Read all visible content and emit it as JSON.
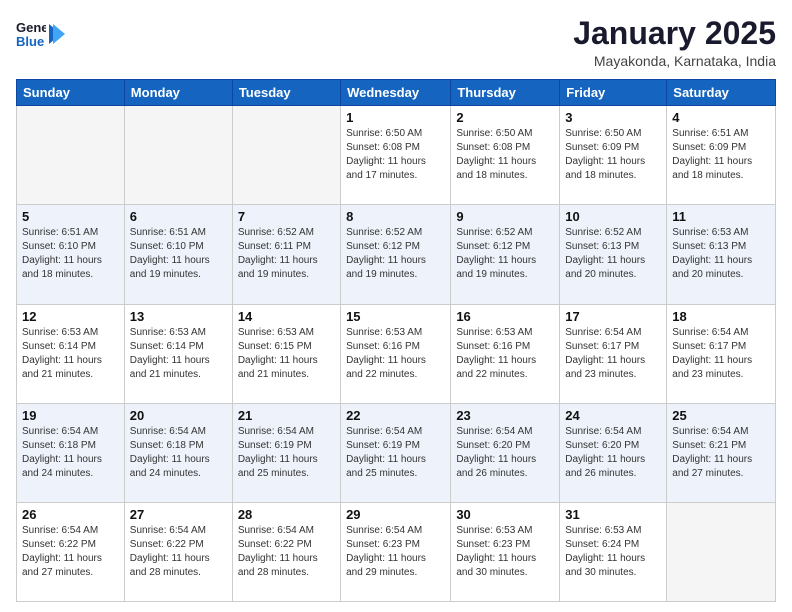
{
  "header": {
    "logo_line1": "General",
    "logo_line2": "Blue",
    "title": "January 2025",
    "subtitle": "Mayakonda, Karnataka, India"
  },
  "weekdays": [
    "Sunday",
    "Monday",
    "Tuesday",
    "Wednesday",
    "Thursday",
    "Friday",
    "Saturday"
  ],
  "weeks": [
    [
      {
        "day": "",
        "info": ""
      },
      {
        "day": "",
        "info": ""
      },
      {
        "day": "",
        "info": ""
      },
      {
        "day": "1",
        "info": "Sunrise: 6:50 AM\nSunset: 6:08 PM\nDaylight: 11 hours\nand 17 minutes."
      },
      {
        "day": "2",
        "info": "Sunrise: 6:50 AM\nSunset: 6:08 PM\nDaylight: 11 hours\nand 18 minutes."
      },
      {
        "day": "3",
        "info": "Sunrise: 6:50 AM\nSunset: 6:09 PM\nDaylight: 11 hours\nand 18 minutes."
      },
      {
        "day": "4",
        "info": "Sunrise: 6:51 AM\nSunset: 6:09 PM\nDaylight: 11 hours\nand 18 minutes."
      }
    ],
    [
      {
        "day": "5",
        "info": "Sunrise: 6:51 AM\nSunset: 6:10 PM\nDaylight: 11 hours\nand 18 minutes."
      },
      {
        "day": "6",
        "info": "Sunrise: 6:51 AM\nSunset: 6:10 PM\nDaylight: 11 hours\nand 19 minutes."
      },
      {
        "day": "7",
        "info": "Sunrise: 6:52 AM\nSunset: 6:11 PM\nDaylight: 11 hours\nand 19 minutes."
      },
      {
        "day": "8",
        "info": "Sunrise: 6:52 AM\nSunset: 6:12 PM\nDaylight: 11 hours\nand 19 minutes."
      },
      {
        "day": "9",
        "info": "Sunrise: 6:52 AM\nSunset: 6:12 PM\nDaylight: 11 hours\nand 19 minutes."
      },
      {
        "day": "10",
        "info": "Sunrise: 6:52 AM\nSunset: 6:13 PM\nDaylight: 11 hours\nand 20 minutes."
      },
      {
        "day": "11",
        "info": "Sunrise: 6:53 AM\nSunset: 6:13 PM\nDaylight: 11 hours\nand 20 minutes."
      }
    ],
    [
      {
        "day": "12",
        "info": "Sunrise: 6:53 AM\nSunset: 6:14 PM\nDaylight: 11 hours\nand 21 minutes."
      },
      {
        "day": "13",
        "info": "Sunrise: 6:53 AM\nSunset: 6:14 PM\nDaylight: 11 hours\nand 21 minutes."
      },
      {
        "day": "14",
        "info": "Sunrise: 6:53 AM\nSunset: 6:15 PM\nDaylight: 11 hours\nand 21 minutes."
      },
      {
        "day": "15",
        "info": "Sunrise: 6:53 AM\nSunset: 6:16 PM\nDaylight: 11 hours\nand 22 minutes."
      },
      {
        "day": "16",
        "info": "Sunrise: 6:53 AM\nSunset: 6:16 PM\nDaylight: 11 hours\nand 22 minutes."
      },
      {
        "day": "17",
        "info": "Sunrise: 6:54 AM\nSunset: 6:17 PM\nDaylight: 11 hours\nand 23 minutes."
      },
      {
        "day": "18",
        "info": "Sunrise: 6:54 AM\nSunset: 6:17 PM\nDaylight: 11 hours\nand 23 minutes."
      }
    ],
    [
      {
        "day": "19",
        "info": "Sunrise: 6:54 AM\nSunset: 6:18 PM\nDaylight: 11 hours\nand 24 minutes."
      },
      {
        "day": "20",
        "info": "Sunrise: 6:54 AM\nSunset: 6:18 PM\nDaylight: 11 hours\nand 24 minutes."
      },
      {
        "day": "21",
        "info": "Sunrise: 6:54 AM\nSunset: 6:19 PM\nDaylight: 11 hours\nand 25 minutes."
      },
      {
        "day": "22",
        "info": "Sunrise: 6:54 AM\nSunset: 6:19 PM\nDaylight: 11 hours\nand 25 minutes."
      },
      {
        "day": "23",
        "info": "Sunrise: 6:54 AM\nSunset: 6:20 PM\nDaylight: 11 hours\nand 26 minutes."
      },
      {
        "day": "24",
        "info": "Sunrise: 6:54 AM\nSunset: 6:20 PM\nDaylight: 11 hours\nand 26 minutes."
      },
      {
        "day": "25",
        "info": "Sunrise: 6:54 AM\nSunset: 6:21 PM\nDaylight: 11 hours\nand 27 minutes."
      }
    ],
    [
      {
        "day": "26",
        "info": "Sunrise: 6:54 AM\nSunset: 6:22 PM\nDaylight: 11 hours\nand 27 minutes."
      },
      {
        "day": "27",
        "info": "Sunrise: 6:54 AM\nSunset: 6:22 PM\nDaylight: 11 hours\nand 28 minutes."
      },
      {
        "day": "28",
        "info": "Sunrise: 6:54 AM\nSunset: 6:22 PM\nDaylight: 11 hours\nand 28 minutes."
      },
      {
        "day": "29",
        "info": "Sunrise: 6:54 AM\nSunset: 6:23 PM\nDaylight: 11 hours\nand 29 minutes."
      },
      {
        "day": "30",
        "info": "Sunrise: 6:53 AM\nSunset: 6:23 PM\nDaylight: 11 hours\nand 30 minutes."
      },
      {
        "day": "31",
        "info": "Sunrise: 6:53 AM\nSunset: 6:24 PM\nDaylight: 11 hours\nand 30 minutes."
      },
      {
        "day": "",
        "info": ""
      }
    ]
  ]
}
